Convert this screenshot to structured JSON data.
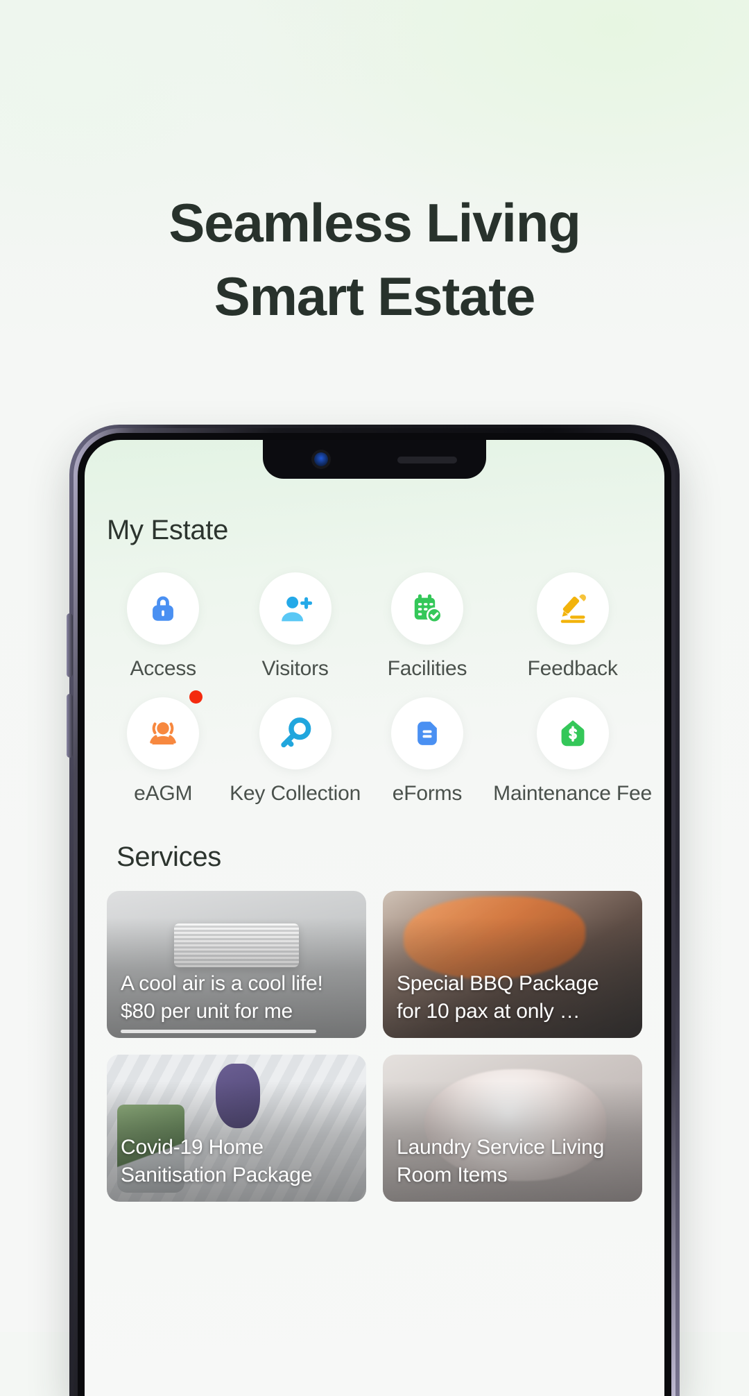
{
  "hero": {
    "line1": "Seamless Living",
    "line2": "Smart Estate",
    "text_color": "#28322c"
  },
  "app": {
    "my_estate": {
      "title": "My Estate",
      "tiles": [
        {
          "label": "Access",
          "icon": "lock-icon",
          "color": "#4a90f2",
          "badge": false
        },
        {
          "label": "Visitors",
          "icon": "person-add-icon",
          "color": "#24a9e8",
          "badge": false
        },
        {
          "label": "Facilities",
          "icon": "calendar-check-icon",
          "color": "#34c759",
          "badge": false
        },
        {
          "label": "Feedback",
          "icon": "pencil-write-icon",
          "color": "#f2b30b",
          "badge": false
        },
        {
          "label": "eAGM",
          "icon": "people-group-icon",
          "color": "#f7883f",
          "badge": true
        },
        {
          "label": "Key Collection",
          "icon": "key-icon",
          "color": "#21a6dd",
          "badge": false
        },
        {
          "label": "eForms",
          "icon": "document-icon",
          "color": "#4a90f2",
          "badge": false
        },
        {
          "label": "Maintenance Fee",
          "icon": "house-dollar-icon",
          "color": "#34c759",
          "badge": false
        }
      ],
      "badge_color": "#f42a0e"
    },
    "services": {
      "title": "Services",
      "cards": [
        {
          "line1": "A cool air is a cool life!",
          "line2": "$80 per unit for me",
          "photo": "air-conditioner",
          "scrollbar": true
        },
        {
          "line1": "Special BBQ Package",
          "line2": "for 10 pax at only …",
          "photo": "bbq-prawn",
          "scrollbar": false
        },
        {
          "line1": "Covid-19 Home",
          "line2": "Sanitisation Package",
          "photo": "sanitiser-spray",
          "scrollbar": false
        },
        {
          "line1": "Laundry Service Living",
          "line2": "Room Items",
          "photo": "laundry-hands",
          "scrollbar": false
        }
      ]
    }
  }
}
